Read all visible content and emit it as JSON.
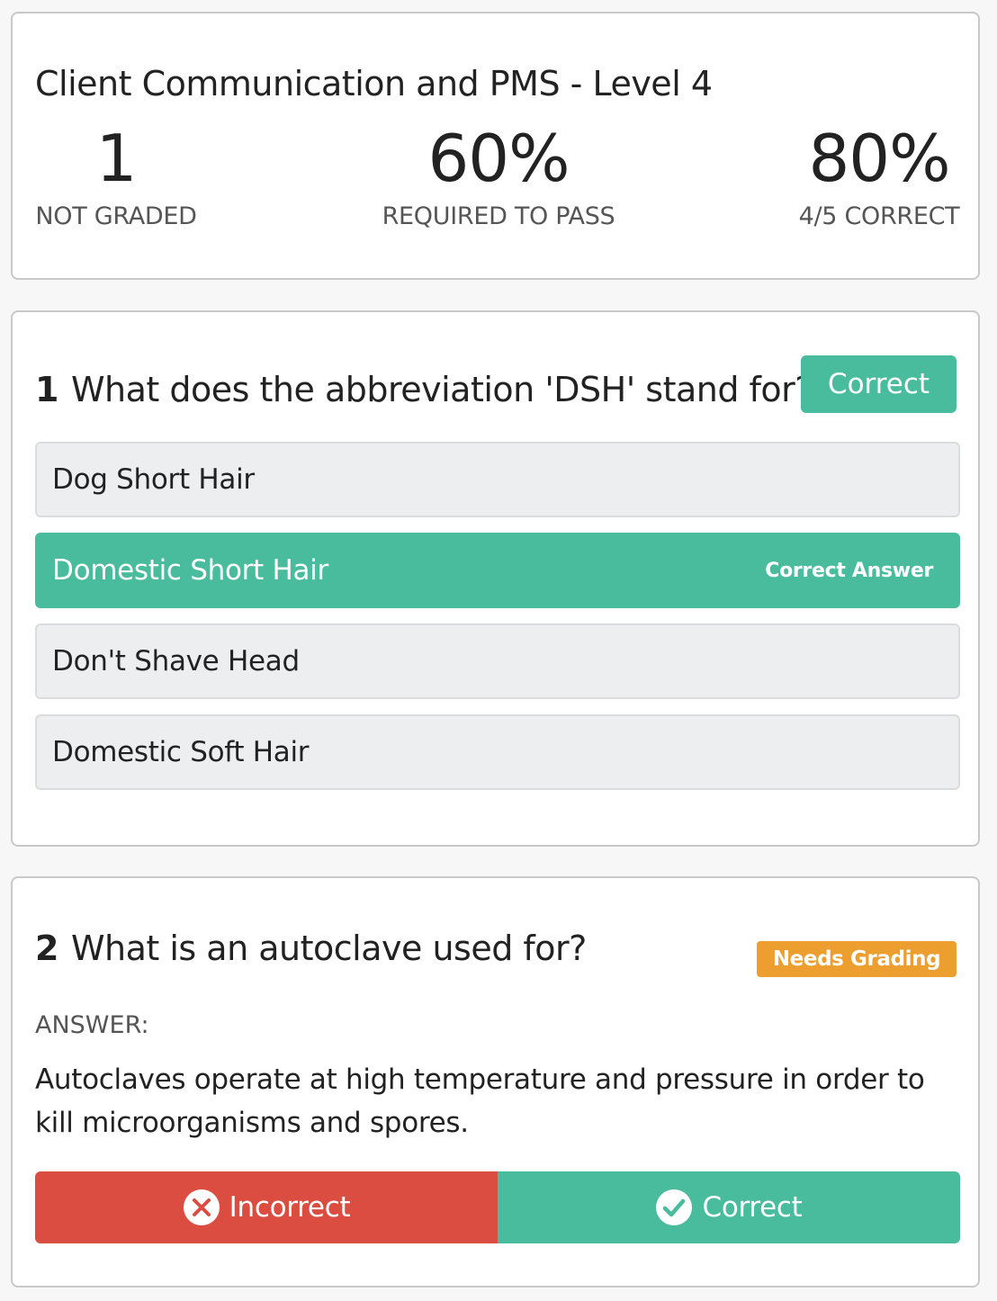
{
  "summary": {
    "title": "Client Communication and PMS - Level 4",
    "stats": [
      {
        "value": "1",
        "label": "NOT GRADED"
      },
      {
        "value": "60%",
        "label": "REQUIRED TO PASS"
      },
      {
        "value": "80%",
        "label": "4/5 CORRECT"
      }
    ]
  },
  "questions": [
    {
      "number": "1",
      "text": "What does the abbreviation 'DSH' stand for?",
      "status": "Correct",
      "options": [
        {
          "label": "Dog Short Hair",
          "tag": ""
        },
        {
          "label": "Domestic Short Hair",
          "tag": "Correct Answer"
        },
        {
          "label": "Don't Shave Head",
          "tag": ""
        },
        {
          "label": "Domestic Soft Hair",
          "tag": ""
        }
      ]
    },
    {
      "number": "2",
      "text": "What is an autoclave used for?",
      "status": "Needs Grading",
      "answer_label": "ANSWER:",
      "answer": "Autoclaves operate at high temperature and pressure in order to kill microorganisms and spores.",
      "actions": {
        "incorrect_label": "Incorrect",
        "correct_label": "Correct"
      }
    }
  ],
  "colors": {
    "correct": "#49bc9d",
    "incorrect": "#dc4d41",
    "needs_grading": "#ec9f2e"
  }
}
